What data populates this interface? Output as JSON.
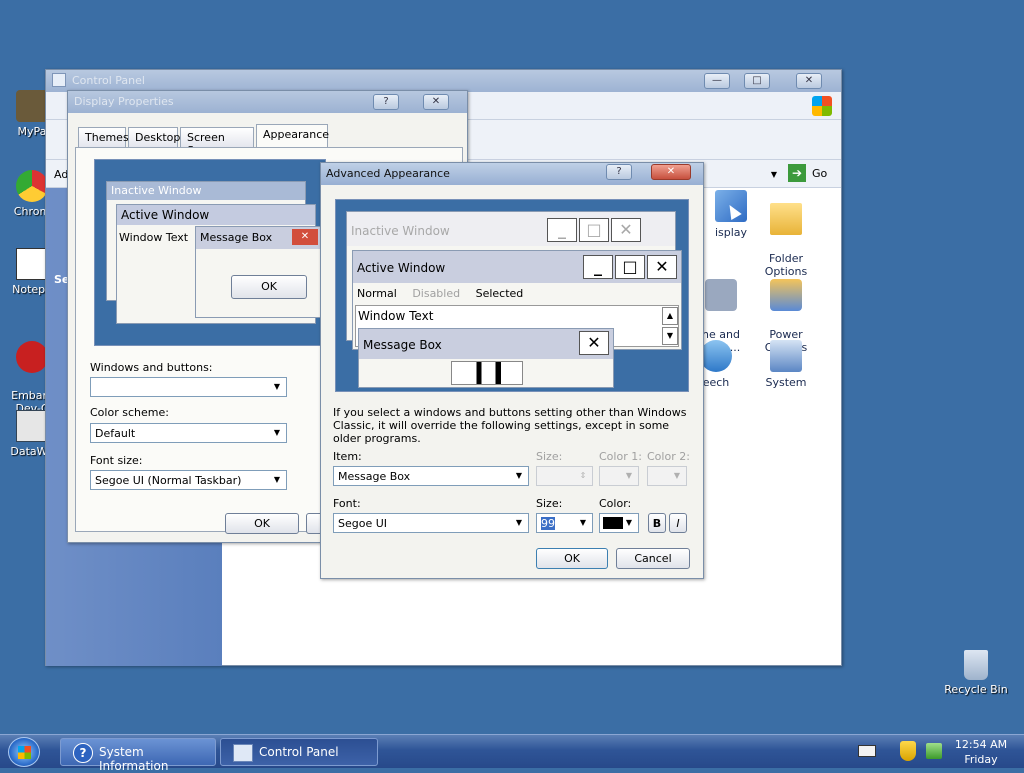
{
  "desktop": {
    "icons": [
      {
        "label": "MyPa"
      },
      {
        "label": "Chrom"
      },
      {
        "label": "Notepa"
      },
      {
        "label": "Embarc\nDev-C"
      },
      {
        "label": "DataWa"
      }
    ],
    "recycle_bin": "Recycle Bin"
  },
  "control_panel": {
    "title": "Control Panel",
    "go_label": "Go",
    "side_fragments": [
      "Ad",
      "Se"
    ],
    "icons": [
      {
        "label": "isplay"
      },
      {
        "label": "Folder\nOptions"
      },
      {
        "label": "ne and\ndem ..."
      },
      {
        "label": "Power\nOptions"
      },
      {
        "label": "eech"
      },
      {
        "label": "System"
      }
    ]
  },
  "display_properties": {
    "title": "Display Properties",
    "tabs": [
      "Themes",
      "Desktop",
      "Screen Saver",
      "Appearance"
    ],
    "preview": {
      "inactive_title": "Inactive Window",
      "active_title": "Active Window",
      "window_text": "Window Text",
      "message_box_title": "Message Box",
      "ok_label": "OK"
    },
    "windows_buttons_label": "Windows and buttons:",
    "windows_buttons_value": "",
    "color_scheme_label": "Color scheme:",
    "color_scheme_value": "Default",
    "font_size_label": "Font size:",
    "font_size_value": "Segoe UI (Normal Taskbar)",
    "ok_label": "OK"
  },
  "advanced": {
    "title": "Advanced Appearance",
    "preview": {
      "inactive_title": "Inactive Window",
      "active_title": "Active Window",
      "menu_normal": "Normal",
      "menu_disabled": "Disabled",
      "menu_selected": "Selected",
      "window_text": "Window Text",
      "message_box_title": "Message Box"
    },
    "notice": "If you select a windows and buttons setting other than Windows Classic, it will override the following settings, except in some older programs.",
    "item_label": "Item:",
    "item_value": "Message Box",
    "size_label": "Size:",
    "color1_label": "Color 1:",
    "color2_label": "Color 2:",
    "font_label": "Font:",
    "font_value": "Segoe UI",
    "font_size_label": "Size:",
    "font_size_value": "99",
    "font_color_label": "Color:",
    "font_color": "#000000",
    "bold_label": "B",
    "italic_label": "I",
    "ok_label": "OK",
    "cancel_label": "Cancel"
  },
  "taskbar": {
    "buttons": [
      {
        "label": "System Information"
      },
      {
        "label": "Control Panel"
      }
    ],
    "clock_time": "12:54 AM",
    "clock_day": "Friday"
  }
}
